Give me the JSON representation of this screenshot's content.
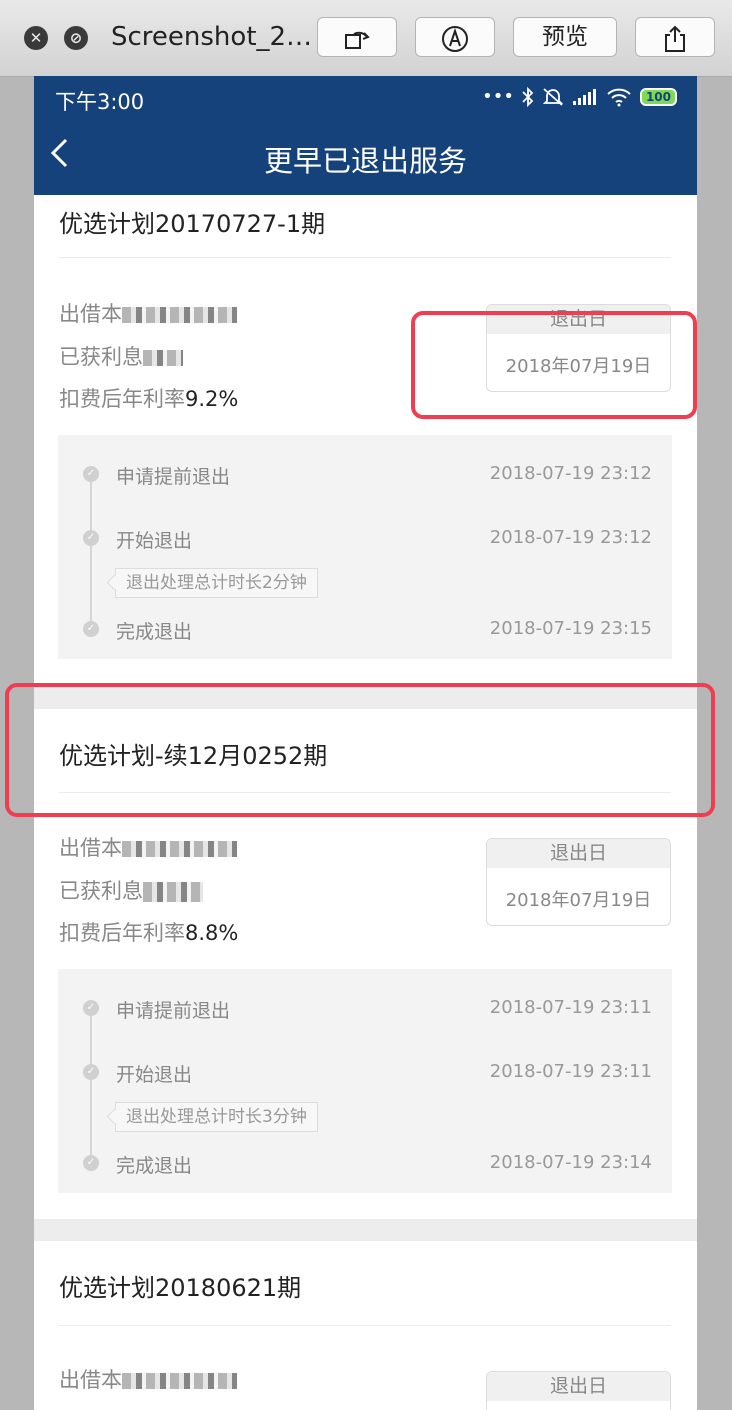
{
  "window": {
    "title": "Screenshot_2…",
    "preview_label": "预览",
    "close_icon": "close-icon",
    "stop_icon": "stop-icon"
  },
  "status_bar": {
    "time": "下午3:00",
    "battery": "100",
    "dots": "•••"
  },
  "nav": {
    "title": "更早已退出服务",
    "back_icon": "chevron-left-icon"
  },
  "common": {
    "principal_label": "出借本",
    "earned_label": "已获利息",
    "rate_label": "扣费后年利率",
    "exit_date_label": "退出日",
    "check_icon": "check-icon"
  },
  "plans": [
    {
      "title": "优选计划20170727-1期",
      "rate": "9.2%",
      "exit_date": "2018年07月19日",
      "steps": [
        {
          "label": "申请提前退出",
          "time": "2018-07-19 23:12"
        },
        {
          "label": "开始退出",
          "time": "2018-07-19 23:12"
        },
        {
          "label": "完成退出",
          "time": "2018-07-19 23:15"
        }
      ],
      "duration_note": "退出处理总计时长2分钟"
    },
    {
      "title": "优选计划-续12月0252期",
      "rate": "8.8%",
      "exit_date": "2018年07月19日",
      "steps": [
        {
          "label": "申请提前退出",
          "time": "2018-07-19 23:11"
        },
        {
          "label": "开始退出",
          "time": "2018-07-19 23:11"
        },
        {
          "label": "完成退出",
          "time": "2018-07-19 23:14"
        }
      ],
      "duration_note": "退出处理总计时长3分钟"
    },
    {
      "title": "优选计划20180621期"
    }
  ],
  "annotation_color": "#ef3d52"
}
